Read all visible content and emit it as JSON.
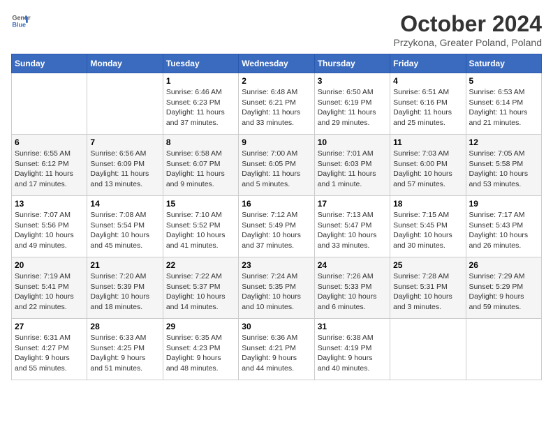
{
  "logo": {
    "line1": "General",
    "line2": "Blue"
  },
  "title": "October 2024",
  "subtitle": "Przykona, Greater Poland, Poland",
  "weekdays": [
    "Sunday",
    "Monday",
    "Tuesday",
    "Wednesday",
    "Thursday",
    "Friday",
    "Saturday"
  ],
  "weeks": [
    [
      {
        "day": "",
        "info": ""
      },
      {
        "day": "",
        "info": ""
      },
      {
        "day": "1",
        "info": "Sunrise: 6:46 AM\nSunset: 6:23 PM\nDaylight: 11 hours\nand 37 minutes."
      },
      {
        "day": "2",
        "info": "Sunrise: 6:48 AM\nSunset: 6:21 PM\nDaylight: 11 hours\nand 33 minutes."
      },
      {
        "day": "3",
        "info": "Sunrise: 6:50 AM\nSunset: 6:19 PM\nDaylight: 11 hours\nand 29 minutes."
      },
      {
        "day": "4",
        "info": "Sunrise: 6:51 AM\nSunset: 6:16 PM\nDaylight: 11 hours\nand 25 minutes."
      },
      {
        "day": "5",
        "info": "Sunrise: 6:53 AM\nSunset: 6:14 PM\nDaylight: 11 hours\nand 21 minutes."
      }
    ],
    [
      {
        "day": "6",
        "info": "Sunrise: 6:55 AM\nSunset: 6:12 PM\nDaylight: 11 hours\nand 17 minutes."
      },
      {
        "day": "7",
        "info": "Sunrise: 6:56 AM\nSunset: 6:09 PM\nDaylight: 11 hours\nand 13 minutes."
      },
      {
        "day": "8",
        "info": "Sunrise: 6:58 AM\nSunset: 6:07 PM\nDaylight: 11 hours\nand 9 minutes."
      },
      {
        "day": "9",
        "info": "Sunrise: 7:00 AM\nSunset: 6:05 PM\nDaylight: 11 hours\nand 5 minutes."
      },
      {
        "day": "10",
        "info": "Sunrise: 7:01 AM\nSunset: 6:03 PM\nDaylight: 11 hours\nand 1 minute."
      },
      {
        "day": "11",
        "info": "Sunrise: 7:03 AM\nSunset: 6:00 PM\nDaylight: 10 hours\nand 57 minutes."
      },
      {
        "day": "12",
        "info": "Sunrise: 7:05 AM\nSunset: 5:58 PM\nDaylight: 10 hours\nand 53 minutes."
      }
    ],
    [
      {
        "day": "13",
        "info": "Sunrise: 7:07 AM\nSunset: 5:56 PM\nDaylight: 10 hours\nand 49 minutes."
      },
      {
        "day": "14",
        "info": "Sunrise: 7:08 AM\nSunset: 5:54 PM\nDaylight: 10 hours\nand 45 minutes."
      },
      {
        "day": "15",
        "info": "Sunrise: 7:10 AM\nSunset: 5:52 PM\nDaylight: 10 hours\nand 41 minutes."
      },
      {
        "day": "16",
        "info": "Sunrise: 7:12 AM\nSunset: 5:49 PM\nDaylight: 10 hours\nand 37 minutes."
      },
      {
        "day": "17",
        "info": "Sunrise: 7:13 AM\nSunset: 5:47 PM\nDaylight: 10 hours\nand 33 minutes."
      },
      {
        "day": "18",
        "info": "Sunrise: 7:15 AM\nSunset: 5:45 PM\nDaylight: 10 hours\nand 30 minutes."
      },
      {
        "day": "19",
        "info": "Sunrise: 7:17 AM\nSunset: 5:43 PM\nDaylight: 10 hours\nand 26 minutes."
      }
    ],
    [
      {
        "day": "20",
        "info": "Sunrise: 7:19 AM\nSunset: 5:41 PM\nDaylight: 10 hours\nand 22 minutes."
      },
      {
        "day": "21",
        "info": "Sunrise: 7:20 AM\nSunset: 5:39 PM\nDaylight: 10 hours\nand 18 minutes."
      },
      {
        "day": "22",
        "info": "Sunrise: 7:22 AM\nSunset: 5:37 PM\nDaylight: 10 hours\nand 14 minutes."
      },
      {
        "day": "23",
        "info": "Sunrise: 7:24 AM\nSunset: 5:35 PM\nDaylight: 10 hours\nand 10 minutes."
      },
      {
        "day": "24",
        "info": "Sunrise: 7:26 AM\nSunset: 5:33 PM\nDaylight: 10 hours\nand 6 minutes."
      },
      {
        "day": "25",
        "info": "Sunrise: 7:28 AM\nSunset: 5:31 PM\nDaylight: 10 hours\nand 3 minutes."
      },
      {
        "day": "26",
        "info": "Sunrise: 7:29 AM\nSunset: 5:29 PM\nDaylight: 9 hours\nand 59 minutes."
      }
    ],
    [
      {
        "day": "27",
        "info": "Sunrise: 6:31 AM\nSunset: 4:27 PM\nDaylight: 9 hours\nand 55 minutes."
      },
      {
        "day": "28",
        "info": "Sunrise: 6:33 AM\nSunset: 4:25 PM\nDaylight: 9 hours\nand 51 minutes."
      },
      {
        "day": "29",
        "info": "Sunrise: 6:35 AM\nSunset: 4:23 PM\nDaylight: 9 hours\nand 48 minutes."
      },
      {
        "day": "30",
        "info": "Sunrise: 6:36 AM\nSunset: 4:21 PM\nDaylight: 9 hours\nand 44 minutes."
      },
      {
        "day": "31",
        "info": "Sunrise: 6:38 AM\nSunset: 4:19 PM\nDaylight: 9 hours\nand 40 minutes."
      },
      {
        "day": "",
        "info": ""
      },
      {
        "day": "",
        "info": ""
      }
    ]
  ]
}
